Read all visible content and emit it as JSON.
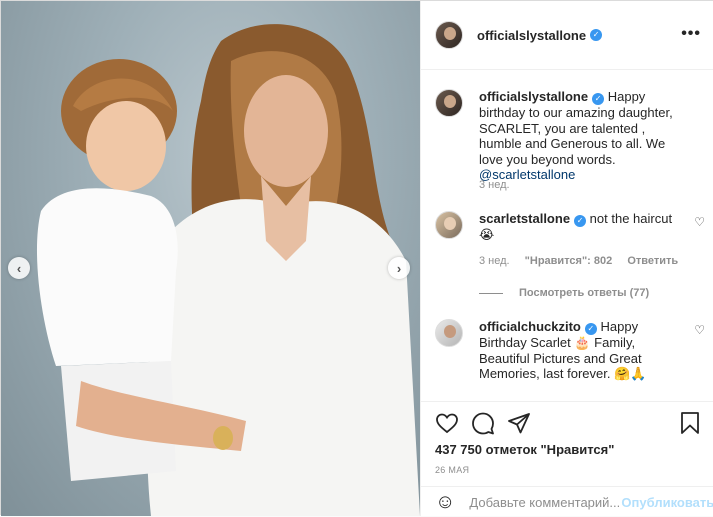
{
  "post": {
    "username": "officialslystallone",
    "verified_mark": "✓",
    "more_label": "•••",
    "nav_left": "‹",
    "nav_right": "›"
  },
  "comments": [
    {
      "username": "officialslystallone",
      "text": "Happy birthday to our amazing daughter, SCARLET, you are talented , humble and Generous to all. We love you beyond words.",
      "mention": "@scarletstallone",
      "time": "3 нед."
    },
    {
      "username": "scarletstallone",
      "text": "not the haircut 😭",
      "time": "3 нед.",
      "likes": "\"Нравится\": 802",
      "reply": "Ответить"
    },
    {
      "username": "officialchuckzito",
      "text": "Happy Birthday Scarlet 🎂 Family, Beautiful Pictures and Great Memories, last forever. 🤗🙏"
    }
  ],
  "view_replies": "Посмотреть ответы (77)",
  "likes_count": "437 750 отметок \"Нравится\"",
  "date": "26 МАЯ",
  "add_comment": {
    "placeholder": "Добавьте комментарий...",
    "emoji_icon": "☺",
    "publish_label": "Опубликовать"
  },
  "icons": [
    "heart-icon",
    "comment-icon",
    "share-icon",
    "bookmark-icon",
    "emoji-icon",
    "ellipsis-icon",
    "chevron-left-icon",
    "chevron-right-icon"
  ],
  "colors": {
    "link": "#00376b",
    "verified": "#3897f0",
    "publish_disabled": "#b2dffc",
    "muted": "#8e8e8e"
  }
}
